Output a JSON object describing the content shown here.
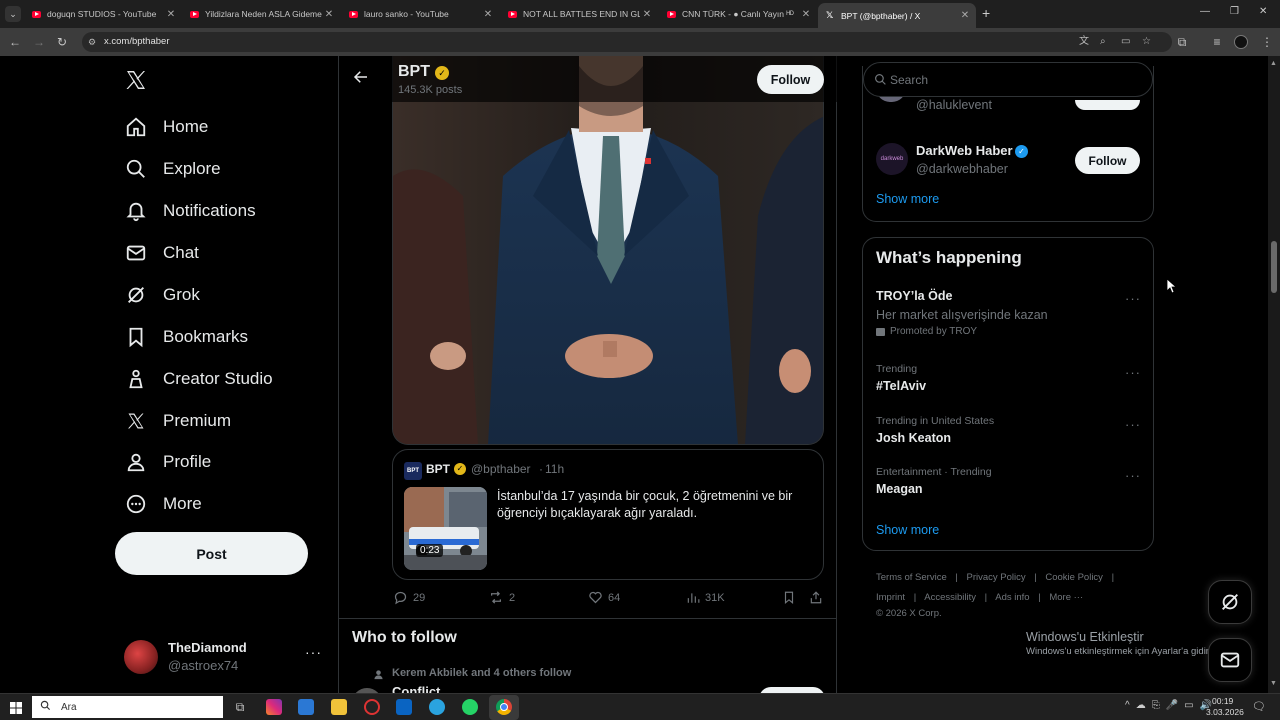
{
  "browser": {
    "tabs": [
      {
        "title": "doguqn STUDIOS - YouTube"
      },
      {
        "title": "Yildizlara Neden ASLA Gidemey"
      },
      {
        "title": "lauro sanko - YouTube"
      },
      {
        "title": "NOT ALL BATTLES END IN GLOR"
      },
      {
        "title": "CNN TÜRK - ● Canlı Yayın ᴴᴰ"
      },
      {
        "title": "BPT (@bpthaber) / X"
      }
    ],
    "url": "x.com/bpthaber"
  },
  "nav": {
    "items": [
      "Home",
      "Explore",
      "Notifications",
      "Chat",
      "Grok",
      "Bookmarks",
      "Creator Studio",
      "Premium",
      "Profile",
      "More"
    ],
    "post_label": "Post",
    "account_name": "TheDiamond",
    "account_handle": "@astroex74"
  },
  "profile_header": {
    "name": "BPT",
    "posts": "145.3K posts",
    "follow_label": "Follow"
  },
  "quote": {
    "logo": "BPT",
    "name": "BPT",
    "handle": "@bpthaber",
    "sep": "·",
    "time": "11h",
    "text": "İstanbul’da 17 yaşında bir çocuk, 2 öğretmenini ve bir öğrenciyi bıçaklayarak ağır yaraladı.",
    "duration": "0:23"
  },
  "actions": {
    "replies": "29",
    "reposts": "2",
    "likes": "64",
    "views": "31K"
  },
  "who_to_follow": {
    "title": "Who to follow",
    "social": "Kerem Akbilek and 4 others follow",
    "first_name": "Conflict"
  },
  "search": {
    "placeholder": "Search"
  },
  "suggestions": {
    "partial_handle": "@haluklevent",
    "user_name": "DarkWeb Haber",
    "user_handle": "@darkwebhaber",
    "avatar_text": "darkweb",
    "follow_label": "Follow",
    "show_more": "Show more"
  },
  "happening": {
    "title": "What’s happening",
    "trends": [
      {
        "context": "",
        "name": "TROY’la Öde",
        "subtitle": "Her market alışverişinde kazan",
        "promoted": "Promoted by TROY"
      },
      {
        "context": "Trending",
        "name": "#TelAviv"
      },
      {
        "context": "Trending in United States",
        "name": "Josh Keaton"
      },
      {
        "context": "Entertainment · Trending",
        "name": "Meagan"
      }
    ],
    "show_more": "Show more"
  },
  "footer": {
    "links": [
      "Terms of Service",
      "Privacy Policy",
      "Cookie Policy",
      "Imprint",
      "Accessibility",
      "Ads info",
      "More ···"
    ],
    "separator": "|",
    "copyright": "© 2026 X Corp."
  },
  "watermark": {
    "title": "Windows'u Etkinleştir",
    "subtitle": "Windows'u etkinleştirmek için Ayarlar'a gidin."
  },
  "taskbar": {
    "search_label": "Ara",
    "time": "00:19",
    "date": "3.03.2026"
  },
  "colors": {
    "verified_gold": "#e2b719",
    "verified_blue": "#1d9bf0",
    "text_primary": "#e7e9ea",
    "text_secondary": "#71767b",
    "border": "#2f3336"
  }
}
